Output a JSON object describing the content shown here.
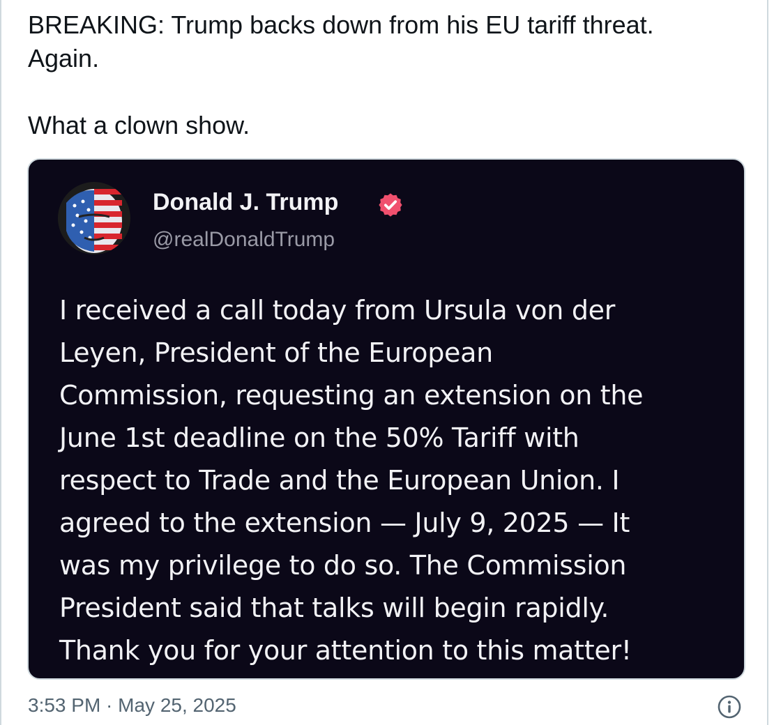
{
  "tweet": {
    "lines": [
      "BREAKING: Trump backs down from his EU tariff threat.",
      "Again.",
      "What a clown show."
    ],
    "timestamp": "3:53 PM · May 25, 2025"
  },
  "embedded_post": {
    "author_name": "Donald J. Trump",
    "author_handle": "@realDonaldTrump",
    "verified_icon": "verified-badge-icon",
    "body_lines": [
      "I received a call today from Ursula von der",
      "Leyen, President of the European",
      "Commission, requesting an extension on the",
      "June 1st deadline on the 50% Tariff with",
      "respect to Trade and the European Union. I",
      "agreed to the extension — July 9, 2025 — It",
      "was my privilege to do so. The Commission",
      "President said that talks will begin rapidly.",
      "Thank you for your attention to this matter!"
    ]
  },
  "colors": {
    "card_background": "#0b0818",
    "verified_badge": "#f0506e",
    "text_primary": "#0f1419",
    "text_secondary": "#536471"
  }
}
